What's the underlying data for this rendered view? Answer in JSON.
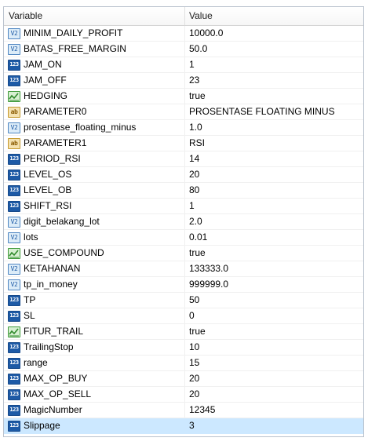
{
  "header": {
    "variable_label": "Variable",
    "value_label": "Value"
  },
  "icon_glyphs": {
    "int": "123",
    "dbl": "V2",
    "str": "ab"
  },
  "rows": [
    {
      "type": "dbl",
      "name": "MINIM_DAILY_PROFIT",
      "value": "10000.0"
    },
    {
      "type": "dbl",
      "name": "BATAS_FREE_MARGIN",
      "value": "50.0"
    },
    {
      "type": "int",
      "name": "JAM_ON",
      "value": "1"
    },
    {
      "type": "int",
      "name": "JAM_OFF",
      "value": "23"
    },
    {
      "type": "bool",
      "name": "HEDGING",
      "value": "true"
    },
    {
      "type": "str",
      "name": "PARAMETER0",
      "value": "PROSENTASE FLOATING MINUS"
    },
    {
      "type": "dbl",
      "name": "prosentase_floating_minus",
      "value": "1.0"
    },
    {
      "type": "str",
      "name": "PARAMETER1",
      "value": "RSI"
    },
    {
      "type": "int",
      "name": "PERIOD_RSI",
      "value": "14"
    },
    {
      "type": "int",
      "name": "LEVEL_OS",
      "value": "20"
    },
    {
      "type": "int",
      "name": "LEVEL_OB",
      "value": "80"
    },
    {
      "type": "int",
      "name": "SHIFT_RSI",
      "value": "1"
    },
    {
      "type": "dbl",
      "name": "digit_belakang_lot",
      "value": "2.0"
    },
    {
      "type": "dbl",
      "name": "lots",
      "value": "0.01"
    },
    {
      "type": "bool",
      "name": "USE_COMPOUND",
      "value": "true"
    },
    {
      "type": "dbl",
      "name": "KETAHANAN",
      "value": "133333.0"
    },
    {
      "type": "dbl",
      "name": "tp_in_money",
      "value": "999999.0"
    },
    {
      "type": "int",
      "name": "TP",
      "value": "50"
    },
    {
      "type": "int",
      "name": "SL",
      "value": "0"
    },
    {
      "type": "bool",
      "name": "FITUR_TRAIL",
      "value": "true"
    },
    {
      "type": "int",
      "name": "TrailingStop",
      "value": "10"
    },
    {
      "type": "int",
      "name": "range",
      "value": "15"
    },
    {
      "type": "int",
      "name": "MAX_OP_BUY",
      "value": "20"
    },
    {
      "type": "int",
      "name": "MAX_OP_SELL",
      "value": "20"
    },
    {
      "type": "int",
      "name": "MagicNumber",
      "value": "12345"
    },
    {
      "type": "int",
      "name": "Slippage",
      "value": "3",
      "selected": true
    }
  ]
}
